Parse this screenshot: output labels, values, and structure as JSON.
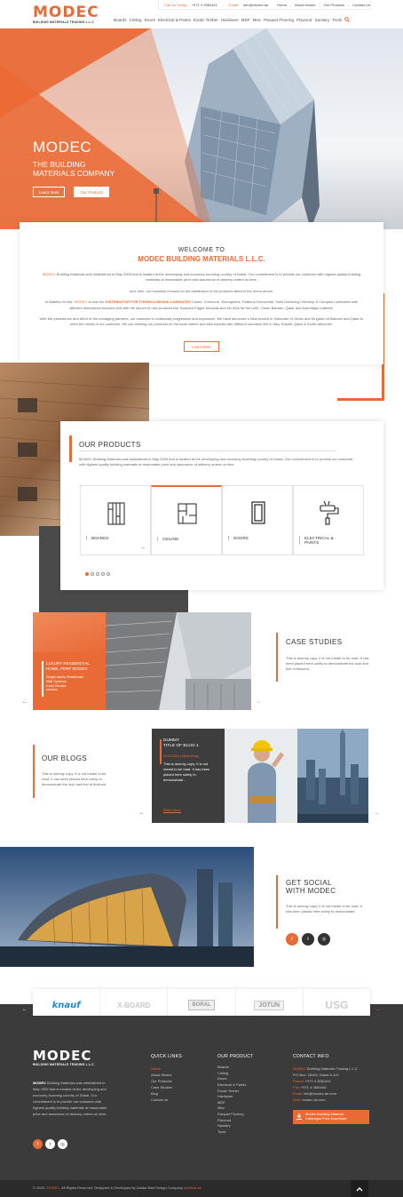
{
  "header": {
    "logo": "MODEC",
    "logo_sub": "BUILDING MATERIALS TRADING L.L.C",
    "call_label": "Call Us Today:",
    "call_value": "+971 4 3581441",
    "email_label": "Email:",
    "email_value": "info@modec.ae",
    "top_links": [
      "Home",
      "About Modec",
      "Our Products",
      "Contact Us"
    ],
    "nav": [
      "Boards",
      "Ceiling",
      "Doors",
      "Electrical & Paints",
      "Exotic Timber",
      "Hardware",
      "MDF",
      "Misc",
      "Parquet Flooring",
      "Plywood",
      "Sanitary",
      "Tools"
    ]
  },
  "hero": {
    "title": "MODEC",
    "subtitle_1": "THE BUILDING",
    "subtitle_2": "MATERIALS COMPANY",
    "btn_learn": "Learn more",
    "btn_products": "Our Products"
  },
  "welcome": {
    "title_1": "WELCOME TO",
    "title_2": "MODEC BUILDING MATERIALS L.L.C.",
    "p1_a": "MODEC",
    "p1_b": " Building Materials was established in May 2005 that is located at the developing and economy-booming country of Dubai. Our commitment is to provide our customer with highest quality building materials at reasonable price and assurance of delivery orders on time.",
    "p2": "Ince then, our business focuses on the distribution of the products listed in the menu above.",
    "p3_a": "In Addition to this, ",
    "p3_b": "MODEC",
    "p3_c": " is now the ",
    "p3_d": "DISTRIBUTOR FOR FORMICA BRAND LAMINATES",
    "p3_e": " Colors, Colorcore, Woodgrains, Patterns Decometal, Solid Surfacing Chemtop & Compact Laminates with different dimensions textures and with the launch of new products like Sculpted Edges Movadia and etc thus for the UAE, Oman Bahrain, Qatar and Azerbaijan markets.",
    "p4": "With the persistence and effort of the managing partners, our business is continually progressive and expansive. We have launched a New branch in Sultanate of Oman and Kingdom of Bahrain and Qatar to meet the needs of our customer. We are catering our products on the local market and also exports with different countries like in Iraq, Kuwait, Qatar & South Africa etc.",
    "btn": "Learn More"
  },
  "products": {
    "title": "OUR PRODUCTS",
    "text": "MODEC Building Materials was established in May 2005 that is located at the developing and economy-booming country of Dubai. Our commitment is to provide our customer with highest quality building materials at reasonable price and assurance of delivery orders on time.",
    "cards": [
      {
        "label": "BOARDS"
      },
      {
        "label": "CEILING"
      },
      {
        "label": "DOORS"
      },
      {
        "label_1": "ELECTRICAL &",
        "label_2": "PAINTS"
      }
    ],
    "arrow": "→"
  },
  "case": {
    "card_title_1": "LUXURY RESIDENTIAL",
    "card_title_2": "HOME, PORT MOODY",
    "card_sub_1": "Single-family Residential",
    "card_sub_2": "Wall Systems",
    "card_sub_3": "Case Studies",
    "card_sub_4": "canada",
    "title": "CASE STUDIES",
    "text": "This is dummy copy. It is not meant to be read. It has been placed here solely to demonstrate the look and feel of finished,"
  },
  "blogs": {
    "title": "OUR BLOGS",
    "text": "This is dummy copy. It is not meant to be read. It has been placed here solely to demonstrate the look and feel of finished,",
    "card_title_1": "DUMMY",
    "card_title_2": "TITLE OF BLOG 1",
    "card_meta": "01.01.2020 | Albert Kong",
    "card_text": "This is dummy copy. It is not meant to be read. It has been placed here solely to demonstrate...",
    "read_more": "Read More"
  },
  "social": {
    "title_1": "GET SOCIAL",
    "title_2": "WITH MODEC",
    "text": "This is dummy copy. It is not meant to be read. It has been placed here solely to demonstrate."
  },
  "brands": [
    "knauf",
    "X-BOARD",
    "BORAL",
    "JOTUN",
    "USG"
  ],
  "footer": {
    "logo": "MODEC",
    "logo_sub": "BUILDING MATERIALS TRADING L.L.C",
    "about_a": "MODEC",
    "about_b": " Building Materials was established in May 2005 that is located at the developing and economy-booming country of Dubai. Our commitment is to provide our customer with highest quality building materials at reasonable price and assurance of delivery orders on time...",
    "quick_title": "QUICK LINKS",
    "quick_links": [
      "Home",
      "About Modec",
      "Our Products",
      "Case Studies",
      "Blog",
      "Contact us"
    ],
    "product_title": "OUR PRODUCT",
    "product_links": [
      "Boards",
      "Ceiling",
      "Doors",
      "Electrical & Paints",
      "Exotic Timber",
      "Hardware",
      "MDF",
      "Misc",
      "Parquet Flooring",
      "Plywood",
      "Sanitary",
      "Tools"
    ],
    "contact_title": "CONTACT INFO",
    "contact_1a": "MODEC",
    "contact_1b": " Building Materials Trading L.L.C",
    "contact_2": "P.O.Box: 28194, Dubai U.A.E",
    "phone_label": "Phone:",
    "phone": " +971 4 3581441",
    "fax_label": "Fax:",
    "fax": " +971 4 3581461",
    "email_label": "Email:",
    "email": " info@modec.ae.com",
    "web_label": "Web:",
    "web": " modec.ae.com",
    "download_1": "Modec Building Material",
    "download_2": "Catalogue Free Download"
  },
  "copyright": {
    "a": "© 2020, ",
    "b": "MODEC",
    "c": ". All Rights Reserved. Designed & Developed by Dallas Web Design Company ",
    "d": "lnnVista.ae"
  },
  "colors": {
    "accent": "#ea6a35",
    "dark": "#3b3b3b"
  }
}
